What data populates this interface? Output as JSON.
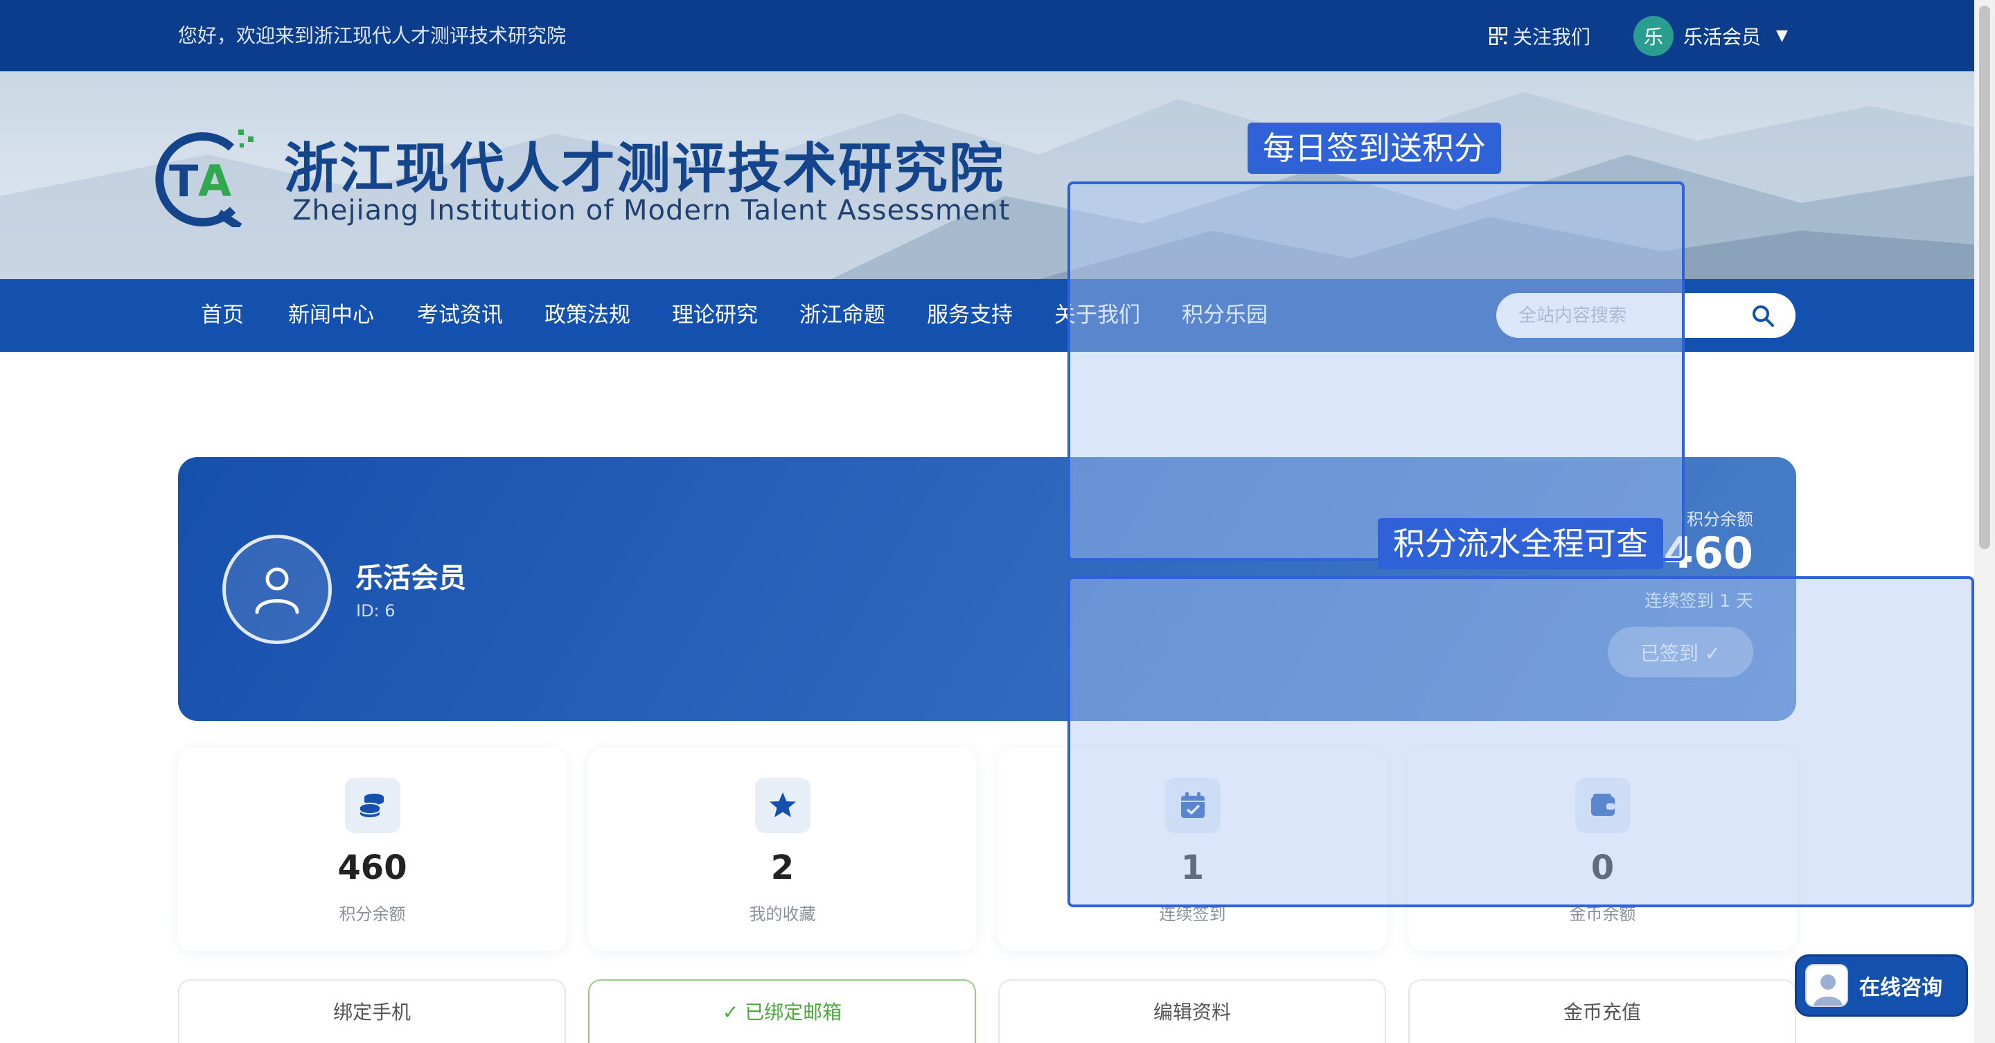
{
  "topbar": {
    "welcome": "您好，欢迎来到浙江现代人才测评技术研究院",
    "follow_label": "关注我们",
    "avatar_char": "乐",
    "username": "乐活会员",
    "caret": "▼"
  },
  "header": {
    "logo_cn": "浙江现代人才测评技术研究院",
    "logo_en": "Zhejiang Institution of Modern Talent Assessment"
  },
  "nav": {
    "items": [
      "首页",
      "新闻中心",
      "考试资讯",
      "政策法规",
      "理论研究",
      "浙江命题",
      "服务支持",
      "关于我们",
      "积分乐园"
    ]
  },
  "search": {
    "placeholder": "全站内容搜索"
  },
  "profile": {
    "name": "乐活会员",
    "id": "ID: 6",
    "balance_label": "积分余额",
    "balance_value": "460",
    "streak": "连续签到 1 天",
    "signed_button": "已签到 ✓"
  },
  "stats": [
    {
      "value": "460",
      "label": "积分余额",
      "icon": "coins-icon"
    },
    {
      "value": "2",
      "label": "我的收藏",
      "icon": "star-icon"
    },
    {
      "value": "1",
      "label": "连续签到",
      "icon": "calendar-check-icon"
    },
    {
      "value": "0",
      "label": "金币余额",
      "icon": "wallet-icon"
    }
  ],
  "actions": [
    {
      "label": "绑定手机"
    },
    {
      "label": "✓ 已绑定邮箱"
    },
    {
      "label": "编辑资料"
    },
    {
      "label": "金币充值"
    }
  ],
  "overlays": {
    "label_1": "每日签到送积分",
    "label_2": "积分流水全程可查"
  },
  "chat": {
    "label": "在线咨询"
  },
  "colors": {
    "topbar_bg": "#0c3c8c",
    "nav_bg": "#1451ae",
    "highlight": "#2f62d6",
    "bound_green": "#4caa3b"
  }
}
